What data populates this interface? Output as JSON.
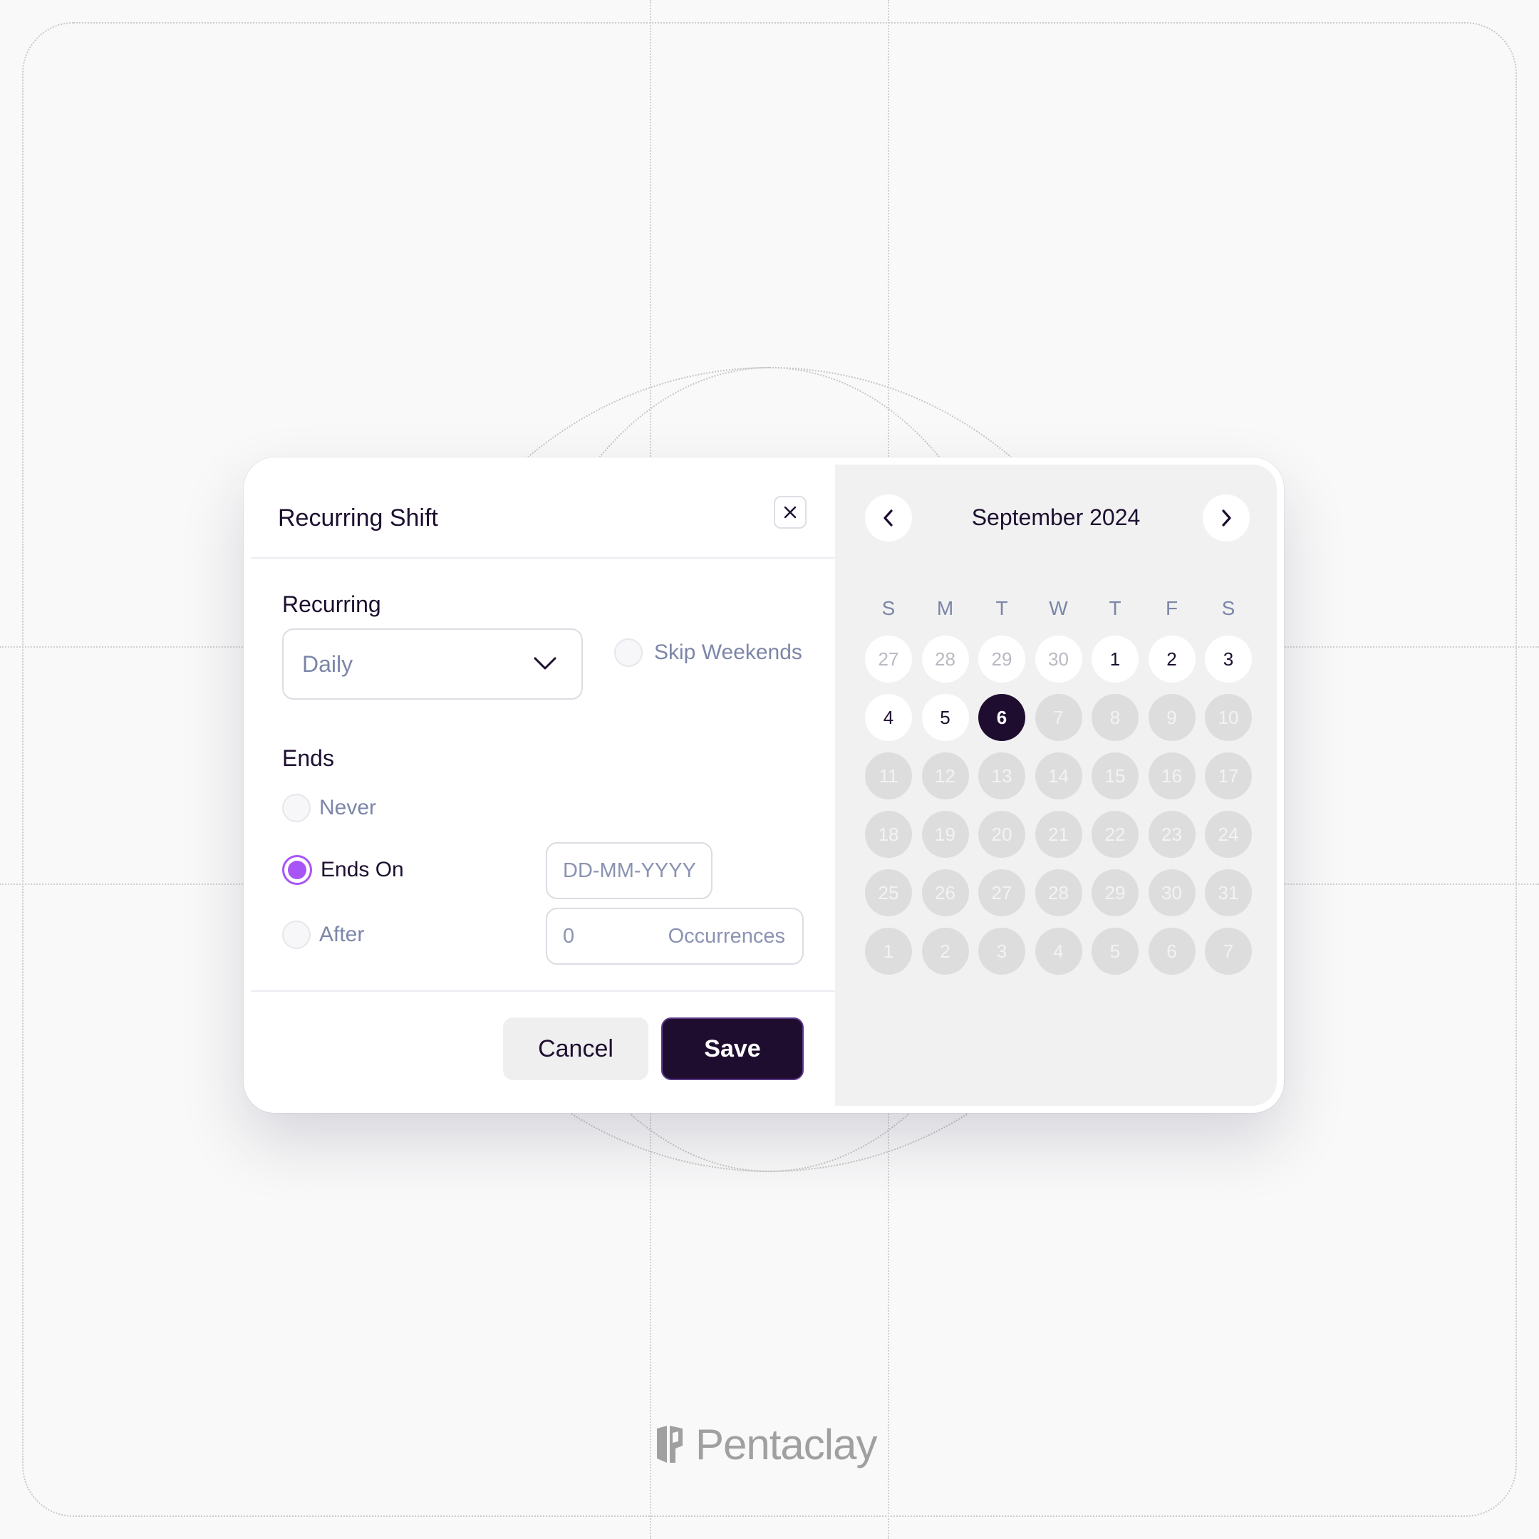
{
  "dialog": {
    "title": "Recurring Shift",
    "recurring_label": "Recurring",
    "recurring_value": "Daily",
    "skip_weekends_label": "Skip Weekends",
    "ends_label": "Ends",
    "options": {
      "never": "Never",
      "ends_on": "Ends On",
      "after": "After"
    },
    "selected_option": "ends_on",
    "date_placeholder": "DD-MM-YYYY",
    "occurrences_value": "0",
    "occurrences_label": "Occurrences",
    "cancel_label": "Cancel",
    "save_label": "Save"
  },
  "calendar": {
    "month_label": "September 2024",
    "weekdays": [
      "S",
      "M",
      "T",
      "W",
      "T",
      "F",
      "S"
    ],
    "weeks": [
      [
        {
          "d": "27",
          "s": "muted"
        },
        {
          "d": "28",
          "s": "muted"
        },
        {
          "d": "29",
          "s": "muted"
        },
        {
          "d": "30",
          "s": "muted"
        },
        {
          "d": "1",
          "s": "in"
        },
        {
          "d": "2",
          "s": "in"
        },
        {
          "d": "3",
          "s": "in"
        }
      ],
      [
        {
          "d": "4",
          "s": "in"
        },
        {
          "d": "5",
          "s": "in"
        },
        {
          "d": "6",
          "s": "selected"
        },
        {
          "d": "7",
          "s": "disabled"
        },
        {
          "d": "8",
          "s": "disabled"
        },
        {
          "d": "9",
          "s": "disabled"
        },
        {
          "d": "10",
          "s": "disabled"
        }
      ],
      [
        {
          "d": "11",
          "s": "disabled"
        },
        {
          "d": "12",
          "s": "disabled"
        },
        {
          "d": "13",
          "s": "disabled"
        },
        {
          "d": "14",
          "s": "disabled"
        },
        {
          "d": "15",
          "s": "disabled"
        },
        {
          "d": "16",
          "s": "disabled"
        },
        {
          "d": "17",
          "s": "disabled"
        }
      ],
      [
        {
          "d": "18",
          "s": "disabled"
        },
        {
          "d": "19",
          "s": "disabled"
        },
        {
          "d": "20",
          "s": "disabled"
        },
        {
          "d": "21",
          "s": "disabled"
        },
        {
          "d": "22",
          "s": "disabled"
        },
        {
          "d": "23",
          "s": "disabled"
        },
        {
          "d": "24",
          "s": "disabled"
        }
      ],
      [
        {
          "d": "25",
          "s": "disabled"
        },
        {
          "d": "26",
          "s": "disabled"
        },
        {
          "d": "27",
          "s": "disabled"
        },
        {
          "d": "28",
          "s": "disabled"
        },
        {
          "d": "29",
          "s": "disabled"
        },
        {
          "d": "30",
          "s": "disabled"
        },
        {
          "d": "31",
          "s": "disabled"
        }
      ],
      [
        {
          "d": "1",
          "s": "disabled"
        },
        {
          "d": "2",
          "s": "disabled"
        },
        {
          "d": "3",
          "s": "disabled"
        },
        {
          "d": "4",
          "s": "disabled"
        },
        {
          "d": "5",
          "s": "disabled"
        },
        {
          "d": "6",
          "s": "disabled"
        },
        {
          "d": "7",
          "s": "disabled"
        }
      ]
    ]
  },
  "brand": {
    "name": "Pentaclay"
  },
  "colors": {
    "primary": "#1f0d30",
    "accent": "#a855f7",
    "muted_text": "#7c86a8"
  },
  "icons": {
    "close": "close-icon",
    "dropdown": "chevron-down-icon",
    "prev": "chevron-left-icon",
    "next": "chevron-right-icon"
  }
}
